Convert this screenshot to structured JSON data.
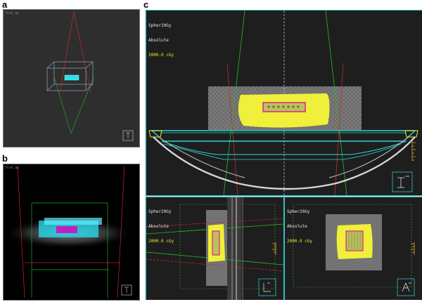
{
  "labels": {
    "a": "a",
    "b": "b",
    "c": "c"
  },
  "panel_a": {
    "corner_text": "Trial_Sp",
    "orientation_icon": "cube-orientation-icon"
  },
  "panel_b": {
    "corner_text": "Trial_Sp",
    "orientation_icon": "cube-orientation-icon"
  },
  "panel_c": {
    "main_view": {
      "line1": "Spher20Gy",
      "line2": "Absolute",
      "line3": "2000.0 cGy",
      "orientation_icon": "axis-I-L-icon"
    },
    "sagittal_view": {
      "line1": "Spher20Gy",
      "line2": "Absolute",
      "line3": "2000.0 cGy",
      "orientation_icon": "axis-L-icon"
    },
    "coronal_view": {
      "line1": "Spher20Gy",
      "line2": "Absolute",
      "line3": "2000.0 cGy",
      "orientation_icon": "axis-A-icon"
    }
  },
  "colors": {
    "background": "#2c2c2c",
    "dose_wash": "#f0f03a",
    "target": "#e0208a",
    "couch": "#30d6d6",
    "beam_red": "#d02828",
    "beam_green": "#28b828"
  }
}
